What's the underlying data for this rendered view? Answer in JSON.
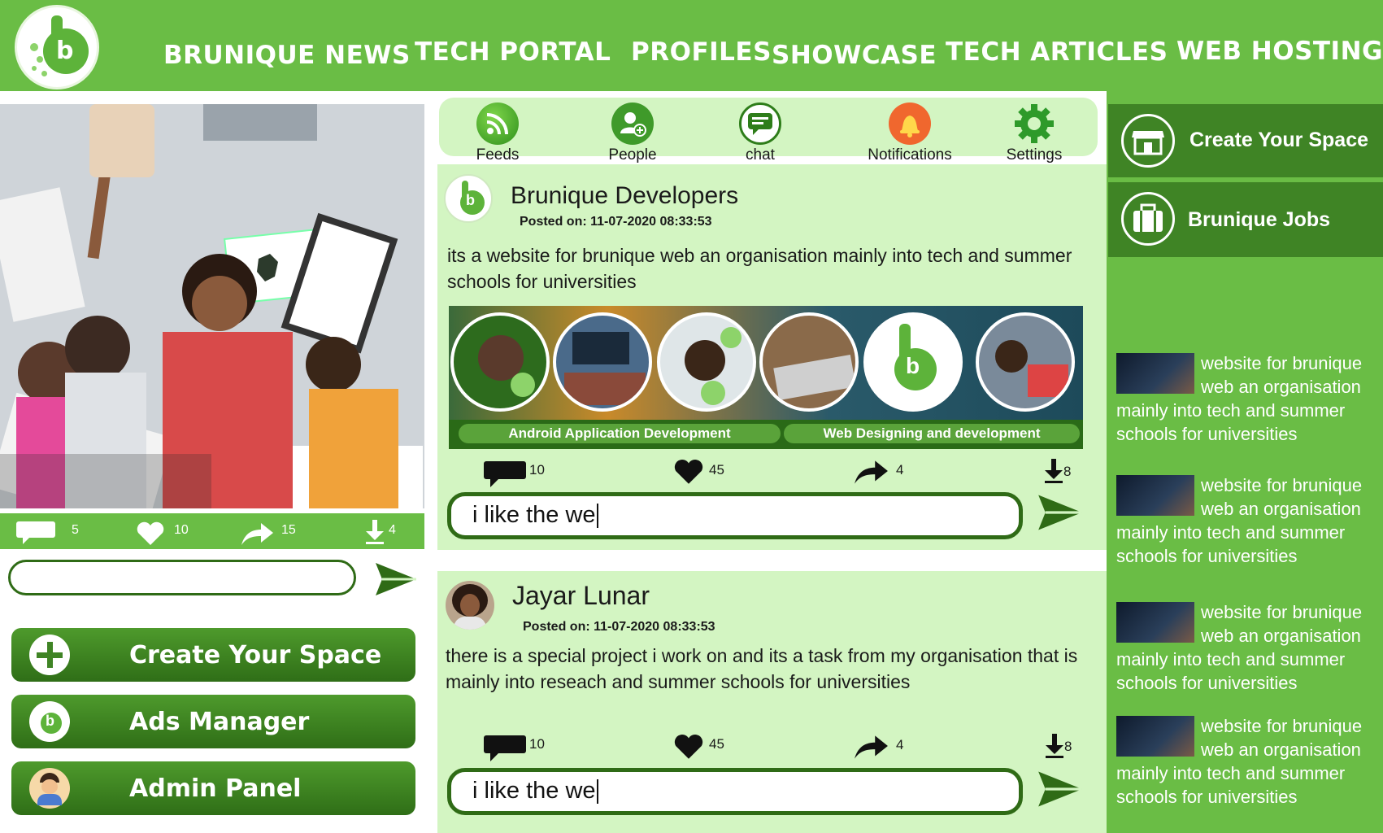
{
  "nav": {
    "items": [
      "BRUNIQUE NEWS",
      "TECH PORTAL",
      "PROFILES",
      "SHOWCASE",
      "TECH ARTICLES",
      "WEB HOSTING"
    ]
  },
  "left": {
    "stats": {
      "comments": "5",
      "likes": "10",
      "shares": "15",
      "downloads": "4"
    },
    "buttons": [
      "Create Your Space",
      "Ads Manager",
      "Admin Panel"
    ]
  },
  "tabs": [
    "Feeds",
    "People",
    "chat",
    "Notifications",
    "Settings"
  ],
  "posts": [
    {
      "author": "Brunique Developers",
      "meta": "Posted on: 11-07-2020      08:33:53",
      "text": "its a website for brunique web  an organisation mainly into tech and summer schools for universities",
      "banner": [
        "Android Application  Development",
        "Web Designing and development"
      ],
      "stats": {
        "comments": "10",
        "likes": "45",
        "shares": "4",
        "downloads": "8"
      },
      "comment": "i like the we"
    },
    {
      "author": "Jayar Lunar",
      "meta": "Posted on: 11-07-2020  08:33:53",
      "text": "there is a special project i work on and its a task from my organisation that is mainly into reseach and summer schools for universities",
      "stats": {
        "comments": "10",
        "likes": "45",
        "shares": "4",
        "downloads": "8"
      },
      "comment": "i like the we"
    }
  ],
  "right": {
    "buttons": [
      "Create Your Space",
      "Brunique Jobs"
    ],
    "items": [
      "website for brunique web  an organisation mainly into tech and summer schools for universities",
      "website for brunique web  an organisation mainly into tech and summer schools for universities",
      "website for brunique web  an organisation mainly into tech and summer schools for universities",
      "website for brunique web  an organisation mainly into tech and summer schools for universities"
    ]
  },
  "colors": {
    "brand_green": "#6abd45",
    "dark_green": "#2f6e17",
    "panel_green": "#d3f5c2"
  }
}
